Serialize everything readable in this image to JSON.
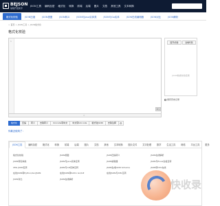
{
  "logo": {
    "name": "BEJSON",
    "tagline": "编程开发助手"
  },
  "topnav": {
    "items": [
      "JSON工具",
      "编码加密",
      "格式化",
      "转换",
      "前端",
      "后端",
      "图片",
      "文档",
      "其他工具",
      "文本转换"
    ]
  },
  "subnav": {
    "items": [
      "格式化校验",
      "JSON压缩",
      "JSON视图",
      "JSON转义",
      "JSON与Java实体类",
      "JSON与Go实体",
      "JSON在线编辑器",
      "JSON对比",
      "JSON解析"
    ]
  },
  "breadcrumb": "> 首页 > JSON工具 > JSON格式化",
  "page_title": "格式化校验",
  "editor": {
    "line_number": "1",
    "foot_grip": "=",
    "button_label": "清空"
  },
  "right_panel": {
    "btn_left": "展开/折叠",
    "btn_right": "复制代码",
    "placeholder": "JSON数据校验结果",
    "checkbox_label": "保存历史记录"
  },
  "toolbar": {
    "buttons": [
      "格式化",
      "压缩",
      "转义",
      "去除转义",
      "Unicode转中文",
      "中文转Unicode",
      "格式化JSON",
      "去除注释"
    ],
    "icon": "⚙"
  },
  "status_text": "你最近使用了：",
  "tabs": {
    "items": [
      "JSON工具",
      "编码加密",
      "格式化",
      "转换",
      "前端",
      "后端",
      "图片",
      "文档",
      "其他",
      "文本转换",
      "图片文件",
      "文字处理",
      "数学",
      "生活工具",
      "网络",
      "平台工具",
      "更多"
    ]
  },
  "links": {
    "col1": [
      "格式化校验",
      "JSON转实体类",
      "XML JSON互转",
      "在线JSON转Python/Go/JSON",
      "JSON对比"
    ],
    "col2": [
      "JSON视图",
      "JSON与Java实体互转",
      "JSON与C#实体互转",
      "在线JSON转Kotlin Go/C#",
      "JSON在线解析"
    ],
    "col3": [
      "JSON压缩转义",
      "JSON编辑器",
      "JSON生成JSON Schema",
      "在线JSON与XML互转"
    ],
    "col4": [
      "JSON在线解析",
      "JSON与Excel表格互转",
      "JSON转CSV在线"
    ]
  },
  "watermark": {
    "text": "快收录"
  },
  "colors": {
    "topbar": "#0e1b33",
    "accent": "#2d6bcf"
  }
}
